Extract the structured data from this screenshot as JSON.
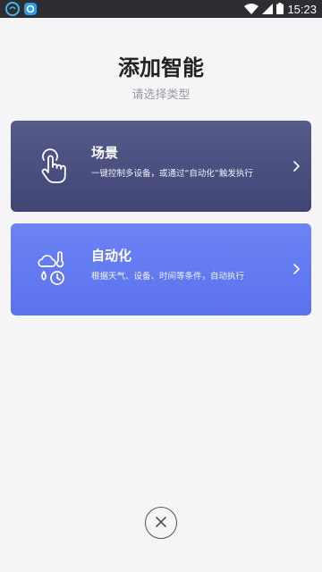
{
  "status_bar": {
    "time": "15:23",
    "icons": [
      "app-notification-icon",
      "app-notification-icon-2",
      "wifi-icon",
      "signal-icon",
      "battery-icon"
    ]
  },
  "header": {
    "title": "添加智能",
    "subtitle": "请选择类型"
  },
  "cards": [
    {
      "title": "场景",
      "description": "一键控制多设备，或通过“自动化”触发执行",
      "icon": "tap-hand-icon",
      "color": "#4a5080"
    },
    {
      "title": "自动化",
      "description": "根据天气、设备、时间等条件，自动执行",
      "icon": "weather-clock-icon",
      "color": "#637af1"
    }
  ],
  "close": {
    "icon": "close-icon"
  },
  "colors": {
    "status_bar": "#2e2e32",
    "background": "#f5f5f7",
    "scene_card": "#4a5080",
    "automation_card": "#637af1"
  }
}
